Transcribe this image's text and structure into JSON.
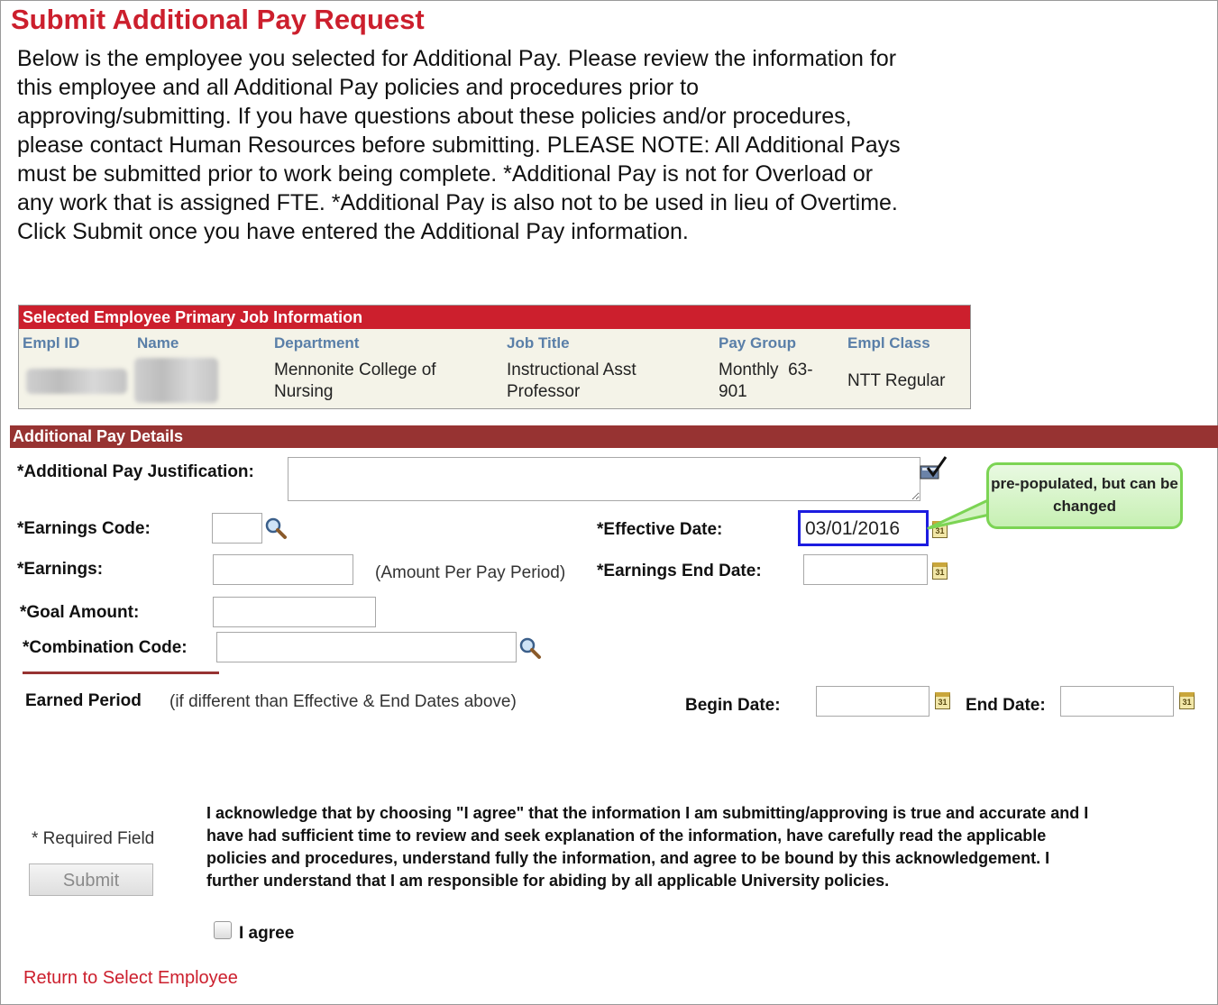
{
  "page": {
    "title": "Submit Additional Pay Request",
    "intro": "Below is the employee you selected for Additional Pay. Please review the information for this employee and all Additional Pay policies and procedures prior to approving/submitting. If you have questions about these policies and/or procedures, please contact Human Resources before submitting. PLEASE NOTE: All Additional Pays must be submitted prior to work being complete. *Additional Pay is not for Overload or any work that is assigned FTE. *Additional Pay is also not to be used in lieu of Overtime. Click Submit once you have entered the Additional Pay information."
  },
  "job": {
    "header": "Selected Employee Primary Job Information",
    "columns": [
      "Empl ID",
      "Name",
      "Department",
      "Job Title",
      "Pay Group",
      "Empl Class"
    ],
    "row": {
      "department_1": "Mennonite College of",
      "department_2": "Nursing",
      "job_title_1": "Instructional Asst",
      "job_title_2": "Professor",
      "pay_group_1": "Monthly  63-",
      "pay_group_2": "901",
      "empl_class": "NTT Regular"
    }
  },
  "details": {
    "header": "Additional Pay Details",
    "justification_label": "*Additional Pay Justification:",
    "earnings_code_label": "*Earnings Code:",
    "effective_date_label": "*Effective Date:",
    "effective_date_value": "03/01/2016",
    "callout": "pre-populated, but can be changed",
    "earnings_label": "*Earnings:",
    "earnings_note": "(Amount Per Pay Period)",
    "earnings_end_label": "*Earnings End Date:",
    "goal_label": "*Goal Amount:",
    "combo_label": "*Combination Code:",
    "earned_period_label": "Earned Period",
    "earned_period_note": "(if different than Effective & End Dates above)",
    "begin_date_label": "Begin Date:",
    "end_date_label": "End Date:"
  },
  "footer": {
    "required": "* Required Field",
    "submit": "Submit",
    "acknowledgement": "I acknowledge that by choosing \"I agree\" that the information I am submitting/approving is true and accurate and I have had sufficient time to review and seek explanation of the information, have carefully read the applicable policies and procedures, understand fully the information, and agree to be bound by this acknowledgement. I further understand that I am responsible for abiding by all applicable University policies.",
    "agree": "I agree",
    "return_link": "Return to Select Employee"
  }
}
